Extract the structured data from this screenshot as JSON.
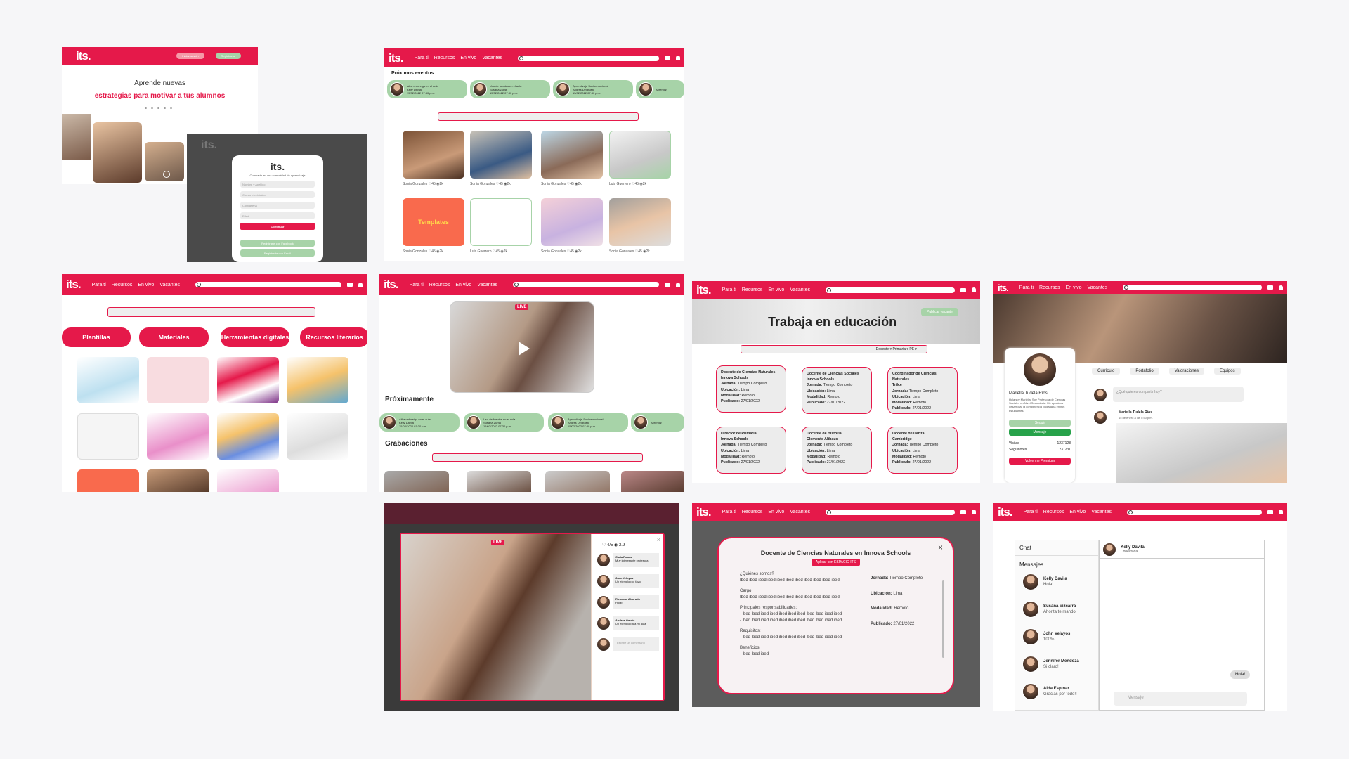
{
  "brand": {
    "logo": "its.",
    "accent": "#e5194a",
    "green": "#a7d3a8"
  },
  "nav": {
    "para_ti": "Para ti",
    "recursos": "Recursos",
    "en_vivo": "En vivo",
    "vacantes": "Vacantes"
  },
  "landing": {
    "header_btn_1": "Iniciar sesión",
    "header_btn_2": "Registrarse",
    "headline_1": "Aprende nuevas",
    "headline_2": "estrategias para motivar a tus alumnos"
  },
  "signup": {
    "logo": "its.",
    "subtitle": "Comparte en una comunidad de aprendizaje",
    "fields": [
      "Nombre y Apellido",
      "Correo electrónico",
      "Contraseña",
      "Edad"
    ],
    "continue": "Continuar",
    "facebook": "Registrarte con Facebook",
    "email": "Registrarte con Email"
  },
  "events": {
    "section_title": "Próximos eventos",
    "items": [
      {
        "title": "Alfra ordoreiga en el aula",
        "host": "Kelly Davila",
        "date": "15/02/2022",
        "time": "07:30 p.m."
      },
      {
        "title": "Uso de fuentes en el aula",
        "host": "Susana Zurita",
        "date": "15/02/2022",
        "time": "07:30 p.m."
      },
      {
        "title": "Aprendizaje Socioemocional",
        "host": "Andrés Del Busto",
        "date": "15/02/2022",
        "time": "07:30 p.m."
      },
      {
        "title": "Aprendiz",
        "host": "",
        "date": "",
        "time": ""
      }
    ]
  },
  "feed": {
    "items": [
      {
        "author": "Sonia Gonzales",
        "likes": "45",
        "views": "2k"
      },
      {
        "author": "Sonia Gonzales",
        "likes": "45",
        "views": "2k"
      },
      {
        "author": "Sonia Gonzales",
        "likes": "45",
        "views": "2k"
      },
      {
        "author": "Luis Guerrero",
        "likes": "45",
        "views": "2k"
      },
      {
        "author": "Sonia Gonzales",
        "likes": "45",
        "views": "2k"
      },
      {
        "author": "Luis Guerrero",
        "likes": "45",
        "views": "2k"
      },
      {
        "author": "Sonia Gonzales",
        "likes": "45",
        "views": "2k"
      },
      {
        "author": "Sonia Gonzales",
        "likes": "45",
        "views": "2k"
      }
    ],
    "templates_tile": "Templates"
  },
  "resources": {
    "categories": [
      "Plantillas",
      "Materiales",
      "Herramientas digitales",
      "Recursos literarios"
    ]
  },
  "live": {
    "badge": "LIVE",
    "upcoming_title": "Próximamente",
    "recordings_title": "Grabaciones",
    "likes": "4/5",
    "views": "2.9",
    "comments": [
      {
        "name": "Carla Rosas",
        "text": "Muy interesante profesora"
      },
      {
        "name": "Juan Velayos",
        "text": "Un ejemplo por favor"
      },
      {
        "name": "Rosanna Alvarado",
        "text": "Hola!!"
      },
      {
        "name": "Andrea García",
        "text": "Un ejemplo para mi aula"
      }
    ],
    "comment_placeholder": "Escribe un comentario"
  },
  "jobs": {
    "title": "Trabaja en educación",
    "publish": "Publicar vacante",
    "filters": [
      "Docente",
      "Primaria",
      "PE"
    ],
    "cards": [
      {
        "title": "Docente de Ciencias Naturales",
        "school": "Innova Schools",
        "jornada": "Tiempo Completo",
        "ubicacion": "Lima",
        "modalidad": "Remoto",
        "publicado": "27/01/2022"
      },
      {
        "title": "Docente de Ciencias Sociales",
        "school": "Innova Schools",
        "jornada": "Tiempo Completo",
        "ubicacion": "Lima",
        "modalidad": "Remoto",
        "publicado": "27/01/2022"
      },
      {
        "title": "Coordinador de Ciencias Naturales",
        "school": "Trilce",
        "jornada": "Tiempo Completo",
        "ubicacion": "Lima",
        "modalidad": "Remoto",
        "publicado": "27/01/2022"
      },
      {
        "title": "Director de Primaria",
        "school": "Innova Schools",
        "jornada": "Tiempo Completo",
        "ubicacion": "Lima",
        "modalidad": "Remoto",
        "publicado": "27/01/2022"
      },
      {
        "title": "Docente de Historia",
        "school": "Clemente Althaus",
        "jornada": "Tiempo Completo",
        "ubicacion": "Lima",
        "modalidad": "Remoto",
        "publicado": "27/01/2022"
      },
      {
        "title": "Docente de Danza",
        "school": "Cambridge",
        "jornada": "Tiempo Completo",
        "ubicacion": "Lima",
        "modalidad": "Remoto",
        "publicado": "27/01/2022"
      }
    ],
    "labels": {
      "jornada": "Jornada:",
      "ubicacion": "Ubicación:",
      "modalidad": "Modalidad:",
      "publicado": "Publicado:"
    }
  },
  "job_detail": {
    "title": "Docente de Ciencias Naturales en Innova Schools",
    "apply": "Aplicar con ESPACIO ITS",
    "q1": "¿Quiénes somos?",
    "lorem": "Ibed ibed ibed ibed ibed ibed ibed ibed ibed ibed ibed",
    "cargo": "Cargo",
    "resp": "Principales responsabilidades:",
    "resp_1": "- ibed ibed ibed ibed ibed ibed ibed  ibed ibed ibed ibed",
    "resp_2": "- ibed ibed ibed ibed ibed ibed ibed  ibed ibed ibed ibed",
    "req": "Requisitos:",
    "req_1": "- ibed ibed ibed ibed ibed ibed ibed  ibed ibed ibed ibed",
    "ben": "Beneficios:",
    "ben_1": "- ibed ibed ibed",
    "jornada": "Jornada:",
    "jornada_v": "Tiempo Completo",
    "ubicacion": "Ubicación:",
    "ubicacion_v": "Lima",
    "modalidad": "Modalidad:",
    "modalidad_v": "Remoto",
    "publicado": "Publicado:",
    "publicado_v": "27/01/2022"
  },
  "profile": {
    "name": "Mariella Tudela Ríos",
    "bio": "Hola soy Mariella. Soy Profesora de Ciencias Sociales en Nivel Secundaria. Me apasiona desarrollar la competencia ciudadana en mis estudiantes.",
    "follow": "Seguir",
    "message": "Mensaje",
    "visits_label": "Visitas",
    "visits": "1237128",
    "followers_label": "Seguidores",
    "followers": "231231",
    "premium": "Volverme Premium",
    "tabs": [
      "Currículo",
      "Portafolio",
      "Valoraciones",
      "Equipos"
    ],
    "compose_placeholder": "¿Qué quieres compartir hoy?",
    "post_author": "Mariella Tudela Ríos",
    "post_date": "15 de enero a las 5:50 p.m."
  },
  "chat": {
    "title": "Chat",
    "messages_label": "Mensajes",
    "active_name": "Kelly Davila",
    "active_status": "Conectada",
    "conversations": [
      {
        "name": "Kelly Davila",
        "last": "Hola!"
      },
      {
        "name": "Susana Vizcarra",
        "last": "Ahorita te mando!"
      },
      {
        "name": "John Velayos",
        "last": "100%"
      },
      {
        "name": "Jennifer Mendoza",
        "last": "Si claro!"
      },
      {
        "name": "Alda Espinar",
        "last": "Gracias por todo!!"
      }
    ],
    "bubble": "Hola!",
    "input_placeholder": "Mensaje"
  }
}
